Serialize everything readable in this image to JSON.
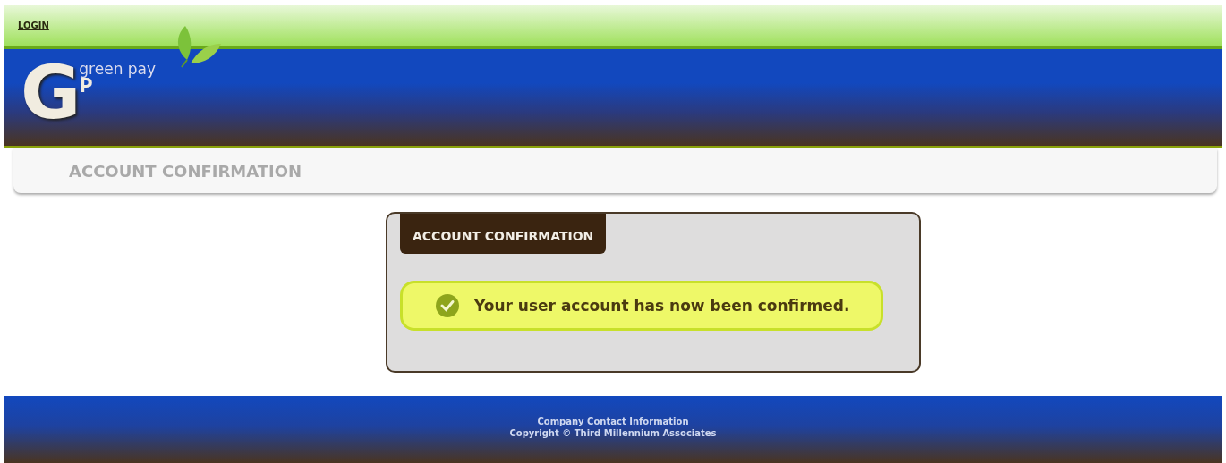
{
  "top_bar": {
    "link": "LOGIN"
  },
  "logo": {
    "letter": "G",
    "sub_letter": "P",
    "name": "green pay"
  },
  "page_title": "ACCOUNT CONFIRMATION",
  "panel": {
    "title": "ACCOUNT CONFIRMATION",
    "message": "Your user account has now been confirmed."
  },
  "footer": {
    "lines": [
      "Company Contact Information",
      "Copyright © Third Millennium Associates"
    ]
  }
}
